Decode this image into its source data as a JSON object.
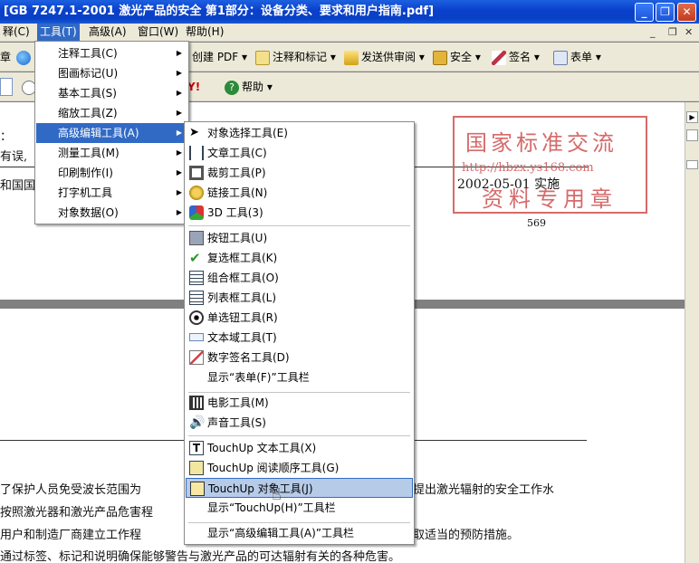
{
  "window": {
    "title": "[GB 7247.1-2001 激光产品的安全 第1部分：设备分类、要求和用户指南.pdf]"
  },
  "menubar": {
    "items": [
      "释(C)",
      "工具(T)",
      "高级(A)",
      "窗口(W)",
      "帮助(H)"
    ]
  },
  "toolbar1": {
    "partial_left": "章",
    "create_pdf": "创建 PDF",
    "comment_markup": "注释和标记",
    "send_review": "发送供审阅",
    "security": "安全",
    "sign": "签名",
    "forms": "表单"
  },
  "toolbar2": {
    "yahoo": "Y!",
    "help": "帮助"
  },
  "tools_menu": {
    "items": [
      "注释工具(C)",
      "图画标记(U)",
      "基本工具(S)",
      "缩放工具(Z)",
      "高级编辑工具(A)",
      "测量工具(M)",
      "印刷制作(I)",
      "打字机工具",
      "对象数据(O)"
    ]
  },
  "advanced_menu": {
    "group1": [
      "对象选择工具(E)",
      "文章工具(C)",
      "裁剪工具(P)",
      "链接工具(N)",
      "3D 工具(3)"
    ],
    "group2": [
      "按钮工具(U)",
      "复选框工具(K)",
      "组合框工具(O)",
      "列表框工具(L)",
      "单选钮工具(R)",
      "文本域工具(T)",
      "数字签名工具(D)",
      "显示“表单(F)”工具栏"
    ],
    "group3": [
      "电影工具(M)",
      "声音工具(S)"
    ],
    "group4": [
      "TouchUp 文本工具(X)",
      "TouchUp 阅读顺序工具(G)",
      "TouchUp 对象工具(J)",
      "显示“TouchUp(H)”工具栏"
    ],
    "group5": [
      "显示“高级编辑工具(A)”工具栏"
    ]
  },
  "document": {
    "page1_left1": "：",
    "page1_left2": "有误,",
    "page1_left3": "和国国",
    "date": "2002-05-01 实施",
    "page_num": "569",
    "stamp_line1": "国家标准交流",
    "stamp_line2": "http://hbzx.ys168.com",
    "stamp_line3": "资料专用章",
    "para1": "了保护人员免受波长范围为",
    "para1_right": "提出激光辐射的安全工作水",
    "para2": "按照激光器和激光产品危害程",
    "para3": "用户和制造厂商建立工作程",
    "para3_right": "取适当的预防措施。",
    "para4": "通过标签、标记和说明确保能够警告与激光产品的可达辐射有关的各种危害。"
  }
}
